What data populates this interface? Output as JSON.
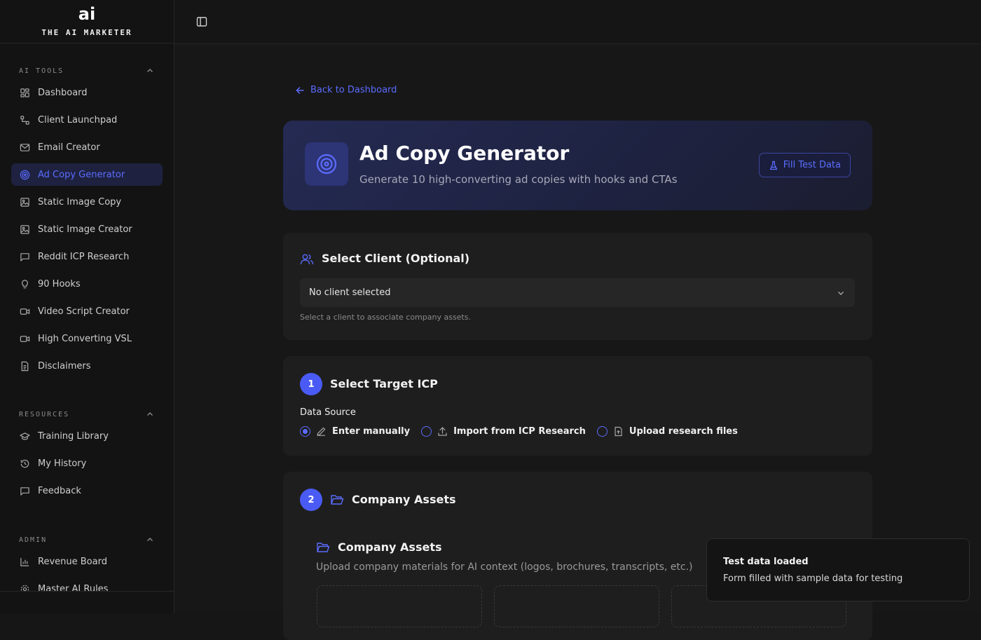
{
  "brand": {
    "logo": "ai",
    "name": "THE AI MARKETER"
  },
  "sidebar": {
    "sections": [
      {
        "title": "AI TOOLS",
        "items": [
          {
            "label": "Dashboard",
            "icon": "grid-icon"
          },
          {
            "label": "Client Launchpad",
            "icon": "nodes-icon"
          },
          {
            "label": "Email Creator",
            "icon": "mail-icon"
          },
          {
            "label": "Ad Copy Generator",
            "icon": "target-icon",
            "active": true
          },
          {
            "label": "Static Image Copy",
            "icon": "image-icon"
          },
          {
            "label": "Static Image Creator",
            "icon": "image-icon"
          },
          {
            "label": "Reddit ICP Research",
            "icon": "message-icon"
          },
          {
            "label": "90 Hooks",
            "icon": "lightbulb-icon"
          },
          {
            "label": "Video Script Creator",
            "icon": "video-icon"
          },
          {
            "label": "High Converting VSL",
            "icon": "video-icon"
          },
          {
            "label": "Disclaimers",
            "icon": "document-icon"
          }
        ]
      },
      {
        "title": "RESOURCES",
        "items": [
          {
            "label": "Training Library",
            "icon": "graduation-cap-icon"
          },
          {
            "label": "My History",
            "icon": "history-icon"
          },
          {
            "label": "Feedback",
            "icon": "message-icon"
          }
        ]
      },
      {
        "title": "ADMIN",
        "items": [
          {
            "label": "Revenue Board",
            "icon": "bar-chart-icon"
          },
          {
            "label": "Master AI Rules",
            "icon": "gear-icon"
          }
        ]
      }
    ]
  },
  "main": {
    "back_link": "Back to Dashboard",
    "hero": {
      "title": "Ad Copy Generator",
      "subtitle": "Generate 10 high-converting ad copies with hooks and CTAs",
      "fill_button": "Fill Test Data"
    },
    "client_card": {
      "title": "Select Client (Optional)",
      "select_value": "No client selected",
      "helper": "Select a client to associate company assets."
    },
    "icp_card": {
      "step": "1",
      "title": "Select Target ICP",
      "field_label": "Data Source",
      "options": [
        {
          "label": "Enter manually",
          "icon": "pencil-icon",
          "selected": true
        },
        {
          "label": "Import from ICP Research",
          "icon": "upload-icon",
          "selected": false
        },
        {
          "label": "Upload research files",
          "icon": "file-upload-icon",
          "selected": false
        }
      ]
    },
    "assets_card": {
      "step": "2",
      "title": "Company Assets",
      "inner_title": "Company Assets",
      "subtitle": "Upload company materials for AI context (logos, brochures, transcripts, etc.)"
    }
  },
  "toast": {
    "title": "Test data loaded",
    "description": "Form filled with sample data for testing"
  },
  "colors": {
    "accent": "#5b6cff",
    "badge": "#4a5bf5",
    "background": "#171717",
    "card": "#1e1e1e"
  }
}
